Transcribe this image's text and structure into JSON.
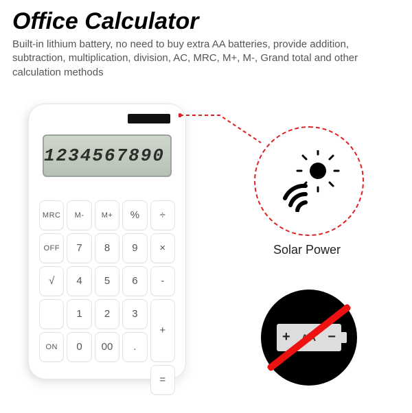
{
  "title": "Office Calculator",
  "description": "Built-in lithium battery, no need to buy extra AA batteries, provide addition, subtraction, multiplication, division, AC, MRC, M+, M-, Grand total and other calculation methods",
  "display_value": "1234567890",
  "solar_label": "Solar Power",
  "battery_minus": "−",
  "battery_plus": "+",
  "battery_text": "AA",
  "keys": {
    "mrc": "MRC",
    "mminus": "M-",
    "mplus": "M+",
    "percent": "%",
    "div": "÷",
    "off": "OFF",
    "k7": "7",
    "k8": "8",
    "k9": "9",
    "mul": "×",
    "sqrt": "√",
    "k4": "4",
    "k5": "5",
    "k6": "6",
    "minus": "-",
    "ce": "",
    "k1": "1",
    "k2": "2",
    "k3": "3",
    "plus": "+",
    "on": "ON",
    "k0": "0",
    "k00": "00",
    "dot": ".",
    "eq": "="
  }
}
